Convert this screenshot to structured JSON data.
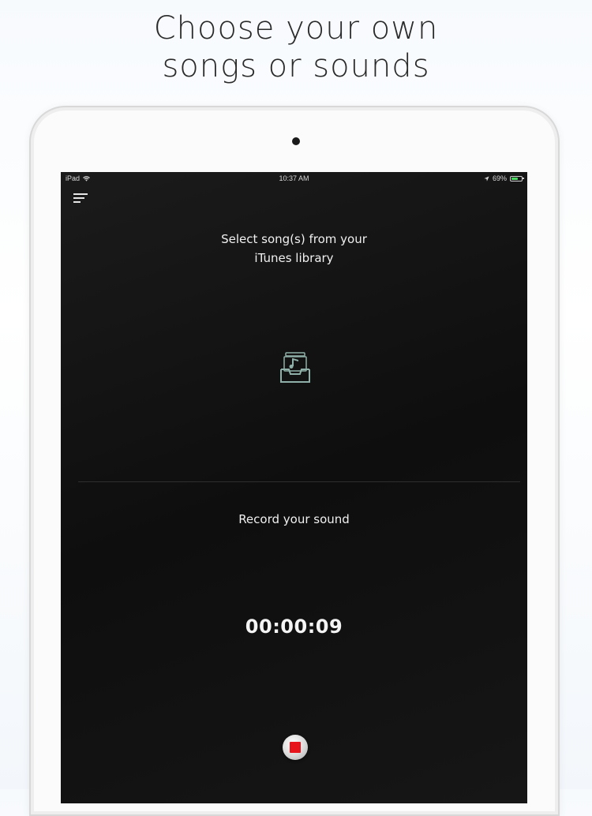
{
  "headline": {
    "line1": "Choose your own",
    "line2": "songs or sounds"
  },
  "status_bar": {
    "device": "iPad",
    "time": "10:37 AM",
    "battery_percent": "69%",
    "battery_level": 0.69,
    "icons": [
      "wifi-icon",
      "location-arrow-icon",
      "battery-icon"
    ],
    "battery_color": "#4cd964"
  },
  "menu": {
    "icon": "menu-icon"
  },
  "library_section": {
    "title_line1": "Select song(s) from your",
    "title_line2": "iTunes library",
    "icon": "music-library-icon"
  },
  "record_section": {
    "title": "Record your sound",
    "timer": "00:00:09",
    "stop_icon": "stop-icon",
    "stop_color": "#e8141c"
  }
}
